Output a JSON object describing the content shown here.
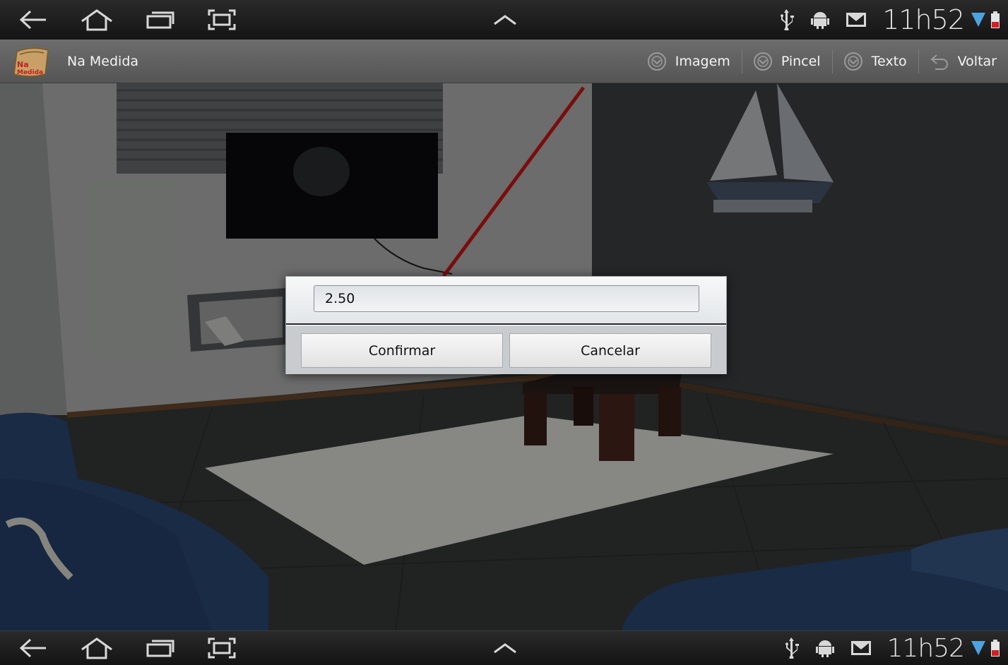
{
  "status_bar": {
    "time": "11h52",
    "icons": [
      "back-icon",
      "home-icon",
      "recent-apps-icon",
      "screenshot-icon",
      "up-chevron-icon",
      "usb-icon",
      "android-debug-icon",
      "gmail-icon",
      "wifi-icon",
      "battery-icon"
    ]
  },
  "action_bar": {
    "app_title": "Na Medida",
    "logo_text": "Na Medida",
    "actions": [
      {
        "label": "Imagem",
        "icon": "dropdown-circle-icon"
      },
      {
        "label": "Pincel",
        "icon": "dropdown-circle-icon"
      },
      {
        "label": "Texto",
        "icon": "dropdown-circle-icon"
      },
      {
        "label": "Voltar",
        "icon": "undo-icon"
      }
    ]
  },
  "dialog": {
    "value": "2.50",
    "confirm_label": "Confirmar",
    "cancel_label": "Cancelar"
  },
  "colors": {
    "measure_line": "#d01818",
    "dialog_divider": "#2a2c2e"
  }
}
